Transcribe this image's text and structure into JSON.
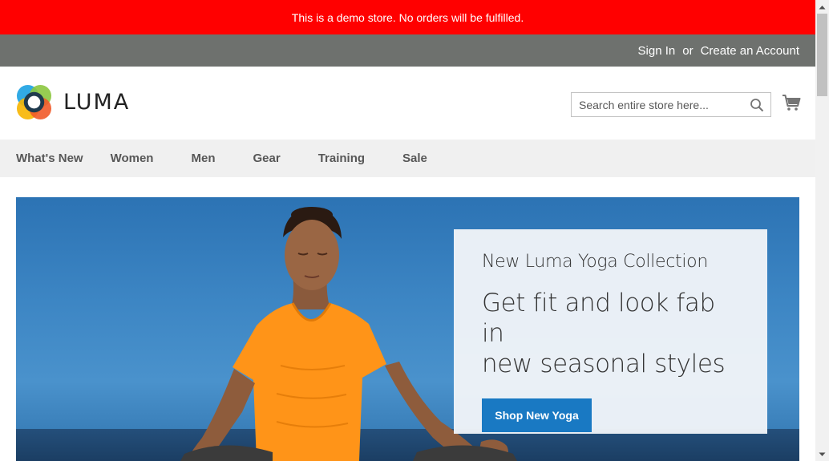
{
  "demo_notice": "This is a demo store. No orders will be fulfilled.",
  "header_links": {
    "sign_in": "Sign In",
    "separator": "or",
    "create_account": "Create an Account"
  },
  "logo": {
    "text": "LUMA",
    "icon": "luma-logo-icon"
  },
  "search": {
    "placeholder": "Search entire store here...",
    "icon": "search-icon"
  },
  "cart": {
    "icon": "cart-icon"
  },
  "nav": {
    "items": [
      {
        "label": "What's New"
      },
      {
        "label": "Women"
      },
      {
        "label": "Men"
      },
      {
        "label": "Gear"
      },
      {
        "label": "Training"
      },
      {
        "label": "Sale"
      }
    ]
  },
  "hero": {
    "kicker": "New Luma Yoga Collection",
    "headline_line1": "Get fit and look fab in",
    "headline_line2": "new seasonal styles",
    "button": "Shop New Yoga"
  },
  "colors": {
    "demo_banner": "#ff0000",
    "header_bar": "#6e716e",
    "nav_bg": "#f0f0f0",
    "button": "#1979c3"
  }
}
